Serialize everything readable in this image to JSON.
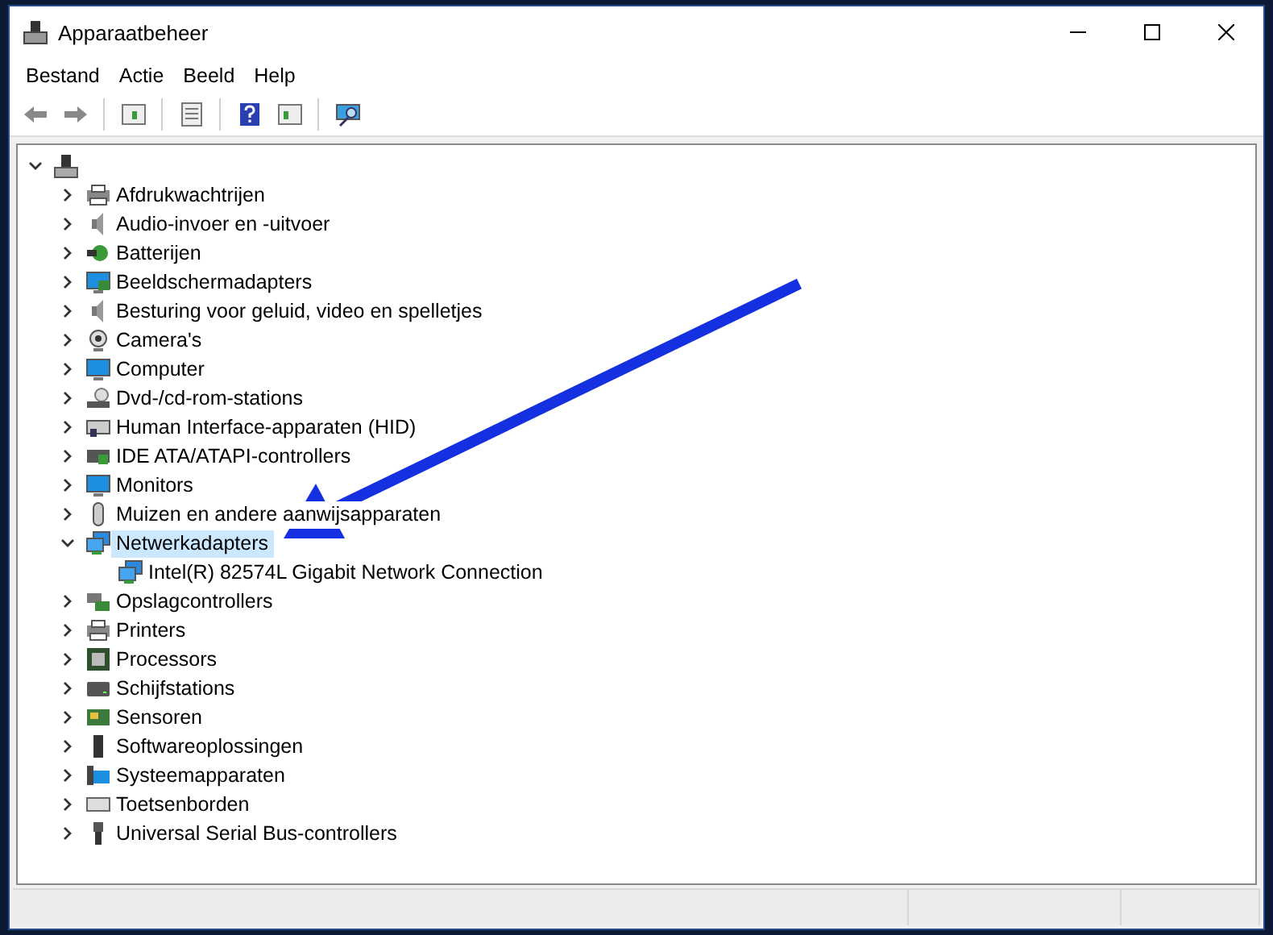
{
  "window": {
    "title": "Apparaatbeheer"
  },
  "menu": [
    "Bestand",
    "Actie",
    "Beeld",
    "Help"
  ],
  "tree": {
    "expanded": true,
    "children": [
      {
        "label": "Afdrukwachtrijen",
        "expanded": false,
        "selected": false
      },
      {
        "label": "Audio-invoer en -uitvoer",
        "expanded": false,
        "selected": false
      },
      {
        "label": "Batterijen",
        "expanded": false,
        "selected": false
      },
      {
        "label": "Beeldschermadapters",
        "expanded": false,
        "selected": false
      },
      {
        "label": "Besturing voor geluid, video en spelletjes",
        "expanded": false,
        "selected": false
      },
      {
        "label": "Camera's",
        "expanded": false,
        "selected": false
      },
      {
        "label": "Computer",
        "expanded": false,
        "selected": false
      },
      {
        "label": "Dvd-/cd-rom-stations",
        "expanded": false,
        "selected": false
      },
      {
        "label": "Human Interface-apparaten (HID)",
        "expanded": false,
        "selected": false
      },
      {
        "label": "IDE ATA/ATAPI-controllers",
        "expanded": false,
        "selected": false
      },
      {
        "label": "Monitors",
        "expanded": false,
        "selected": false
      },
      {
        "label": "Muizen en andere aanwijsapparaten",
        "expanded": false,
        "selected": false
      },
      {
        "label": "Netwerkadapters",
        "expanded": true,
        "selected": true,
        "children": [
          {
            "label": "Intel(R) 82574L Gigabit Network Connection",
            "selected": false
          }
        ]
      },
      {
        "label": "Opslagcontrollers",
        "expanded": false,
        "selected": false
      },
      {
        "label": "Printers",
        "expanded": false,
        "selected": false
      },
      {
        "label": "Processors",
        "expanded": false,
        "selected": false
      },
      {
        "label": "Schijfstations",
        "expanded": false,
        "selected": false
      },
      {
        "label": "Sensoren",
        "expanded": false,
        "selected": false
      },
      {
        "label": "Softwareoplossingen",
        "expanded": false,
        "selected": false
      },
      {
        "label": "Systeemapparaten",
        "expanded": false,
        "selected": false
      },
      {
        "label": "Toetsenborden",
        "expanded": false,
        "selected": false
      },
      {
        "label": "Universal Serial Bus-controllers",
        "expanded": false,
        "selected": false
      }
    ]
  }
}
